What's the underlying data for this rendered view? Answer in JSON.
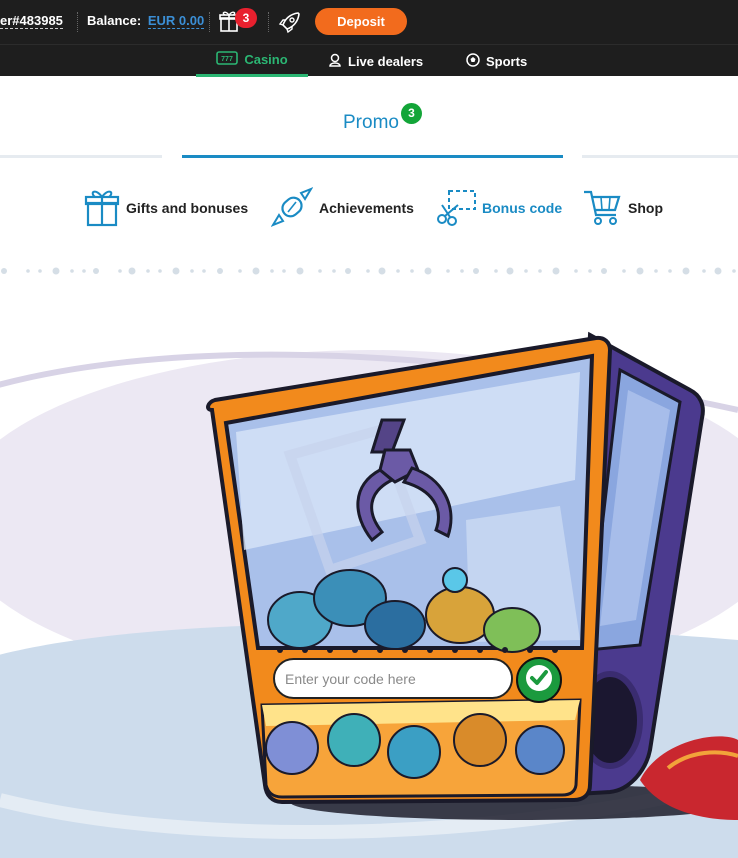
{
  "header": {
    "user_id": "er#483985",
    "balance_label": "Balance:",
    "balance_value": "EUR 0.00",
    "gift_count": "3",
    "deposit_label": "Deposit"
  },
  "nav": {
    "items": [
      {
        "label": "Casino",
        "icon": "casino-icon",
        "active": true
      },
      {
        "label": "Live dealers",
        "icon": "dealer-icon",
        "active": false
      },
      {
        "label": "Sports",
        "icon": "soccer-ball-icon",
        "active": false
      }
    ]
  },
  "promo": {
    "title": "Promo",
    "badge": "3"
  },
  "categories": [
    {
      "label": "Gifts and bonuses",
      "icon": "gift-icon",
      "active": false
    },
    {
      "label": "Achievements",
      "icon": "candy-icon",
      "active": false
    },
    {
      "label": "Bonus code",
      "icon": "scissors-coupon-icon",
      "active": true
    },
    {
      "label": "Shop",
      "icon": "cart-icon",
      "active": false
    }
  ],
  "bonus_code": {
    "placeholder": "Enter your code here"
  },
  "colors": {
    "accent": "#1a8bc4",
    "green": "#2bb673",
    "deposit": "#f26b1d",
    "badge_red": "#e8202e"
  }
}
